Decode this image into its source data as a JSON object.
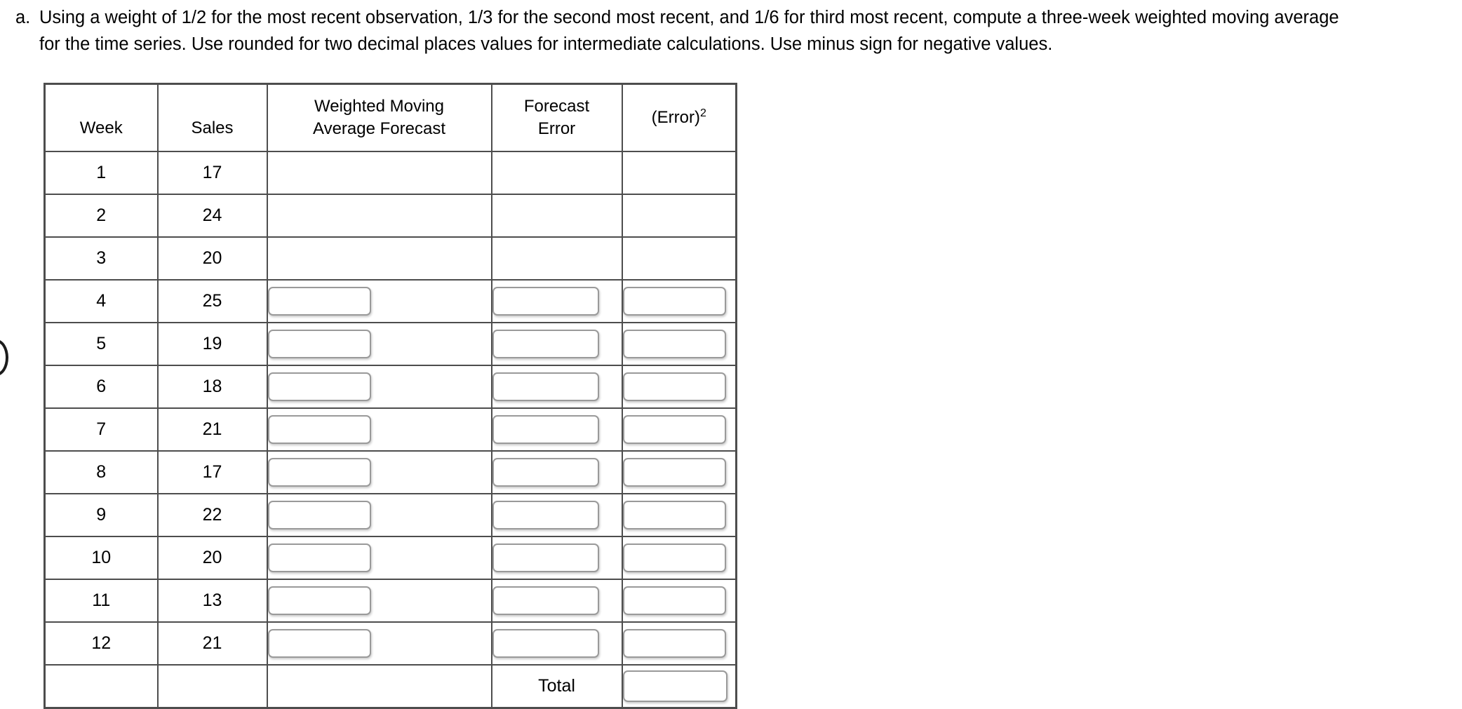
{
  "prompt": {
    "marker": "a.",
    "line1": "Using a weight of 1/2 for the most recent observation, 1/3 for the second most recent, and 1/6 for third most recent, compute a three-week weighted moving average",
    "line2": "for the time series. Use rounded for two decimal places values for intermediate calculations. Use minus sign for negative values."
  },
  "table": {
    "headers": {
      "week": "Week",
      "sales": "Sales",
      "wma_line1": "Weighted Moving",
      "wma_line2": "Average Forecast",
      "error_line1": "Forecast",
      "error_line2": "Error",
      "sq_base": "(Error)",
      "sq_exp": "2"
    },
    "rows": [
      {
        "week": "1",
        "sales": "17",
        "wma_input": "",
        "error_input": "",
        "sq_input": "",
        "has_inputs": false
      },
      {
        "week": "2",
        "sales": "24",
        "wma_input": "",
        "error_input": "",
        "sq_input": "",
        "has_inputs": false
      },
      {
        "week": "3",
        "sales": "20",
        "wma_input": "",
        "error_input": "",
        "sq_input": "",
        "has_inputs": false
      },
      {
        "week": "4",
        "sales": "25",
        "wma_input": "",
        "error_input": "",
        "sq_input": "",
        "has_inputs": true
      },
      {
        "week": "5",
        "sales": "19",
        "wma_input": "",
        "error_input": "",
        "sq_input": "",
        "has_inputs": true
      },
      {
        "week": "6",
        "sales": "18",
        "wma_input": "",
        "error_input": "",
        "sq_input": "",
        "has_inputs": true
      },
      {
        "week": "7",
        "sales": "21",
        "wma_input": "",
        "error_input": "",
        "sq_input": "",
        "has_inputs": true
      },
      {
        "week": "8",
        "sales": "17",
        "wma_input": "",
        "error_input": "",
        "sq_input": "",
        "has_inputs": true
      },
      {
        "week": "9",
        "sales": "22",
        "wma_input": "",
        "error_input": "",
        "sq_input": "",
        "has_inputs": true
      },
      {
        "week": "10",
        "sales": "20",
        "wma_input": "",
        "error_input": "",
        "sq_input": "",
        "has_inputs": true
      },
      {
        "week": "11",
        "sales": "13",
        "wma_input": "",
        "error_input": "",
        "sq_input": "",
        "has_inputs": true
      },
      {
        "week": "12",
        "sales": "21",
        "wma_input": "",
        "error_input": "",
        "sq_input": "",
        "has_inputs": true
      }
    ],
    "total_row": {
      "week": "",
      "sales": "",
      "wma": "",
      "label": "Total",
      "total_input": ""
    }
  },
  "colors": {
    "table_border": "#4d4d4d",
    "input_border": "#9a9a9a",
    "text": "#000000",
    "background": "#ffffff"
  }
}
